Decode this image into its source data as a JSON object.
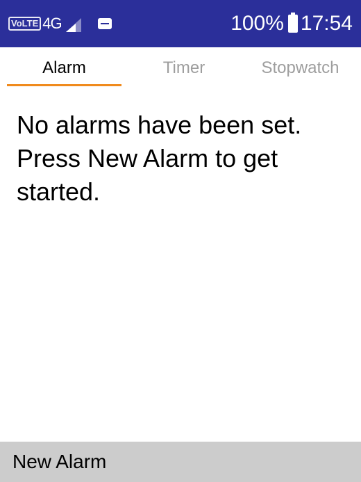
{
  "status_bar": {
    "volte": "VoLTE",
    "network": "4G",
    "signal_icon": "signal-icon",
    "message_icon": "message-icon",
    "battery_percent": "100%",
    "battery_icon": "battery-full-icon",
    "time": "17:54",
    "background": "#2b2f9a"
  },
  "tabs": [
    {
      "label": "Alarm",
      "selected": true
    },
    {
      "label": "Timer",
      "selected": false
    },
    {
      "label": "Stopwatch",
      "selected": false
    }
  ],
  "accent_color": "#f08a1c",
  "main": {
    "empty_message": "No alarms have been set. Press New Alarm to get started."
  },
  "softkeys": {
    "left": "New Alarm"
  }
}
